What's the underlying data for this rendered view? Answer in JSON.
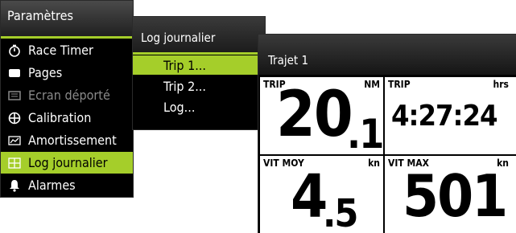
{
  "settings_menu": {
    "title": "Paramètres",
    "items": [
      {
        "label": "Race Timer",
        "icon": "stopwatch-icon"
      },
      {
        "label": "Pages",
        "icon": "pages-icon"
      },
      {
        "label": "Ecran déporté",
        "icon": "remote-display-icon"
      },
      {
        "label": "Calibration",
        "icon": "calibration-icon"
      },
      {
        "label": "Amortissement",
        "icon": "damping-icon"
      },
      {
        "label": "Log journalier",
        "icon": "trip-log-icon"
      },
      {
        "label": "Alarmes",
        "icon": "bell-icon"
      }
    ],
    "selected": "Log journalier",
    "disabled": "Ecran déporté"
  },
  "log_menu": {
    "title": "Log journalier",
    "items": [
      "Trip 1...",
      "Trip 2...",
      "Log..."
    ],
    "selected": "Trip 1..."
  },
  "trip_page": {
    "title": "Trajet 1",
    "cells": [
      {
        "label": "TRIP",
        "unit": "NM",
        "value_int": "20",
        "value_dec": ".1"
      },
      {
        "label": "TRIP",
        "unit": "hrs",
        "value": "4:27:24"
      },
      {
        "label": "VIT MOY",
        "unit": "kn",
        "value_int": "4",
        "value_dec": ".5"
      },
      {
        "label": "VIT MAX",
        "unit": "kn",
        "value": "501"
      }
    ]
  },
  "colors": {
    "accent": "#a5ce2a",
    "panel_bg": "#000000",
    "cell_bg": "#ffffff"
  }
}
